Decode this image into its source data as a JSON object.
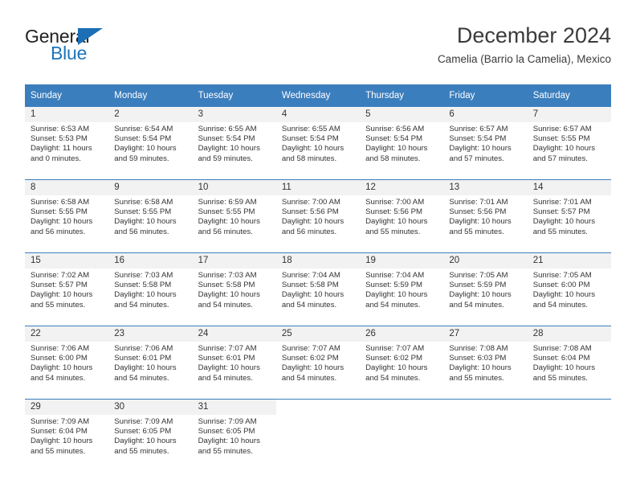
{
  "brand": {
    "name_part1": "General",
    "name_part2": "Blue",
    "accent_color": "#1c75bc",
    "triangle_color": "#1c6fb5"
  },
  "header": {
    "title": "December 2024",
    "subtitle": "Camelia (Barrio la Camelia), Mexico"
  },
  "theme": {
    "header_bg": "#3b7ebd",
    "daynum_bg": "#f2f2f2",
    "grid_line": "#3b7ebd",
    "text": "#333333"
  },
  "weekdays": [
    "Sunday",
    "Monday",
    "Tuesday",
    "Wednesday",
    "Thursday",
    "Friday",
    "Saturday"
  ],
  "weeks": [
    [
      {
        "day": "1",
        "sunrise": "Sunrise: 6:53 AM",
        "sunset": "Sunset: 5:53 PM",
        "daylight_line1": "Daylight: 11 hours",
        "daylight_line2": "and 0 minutes."
      },
      {
        "day": "2",
        "sunrise": "Sunrise: 6:54 AM",
        "sunset": "Sunset: 5:54 PM",
        "daylight_line1": "Daylight: 10 hours",
        "daylight_line2": "and 59 minutes."
      },
      {
        "day": "3",
        "sunrise": "Sunrise: 6:55 AM",
        "sunset": "Sunset: 5:54 PM",
        "daylight_line1": "Daylight: 10 hours",
        "daylight_line2": "and 59 minutes."
      },
      {
        "day": "4",
        "sunrise": "Sunrise: 6:55 AM",
        "sunset": "Sunset: 5:54 PM",
        "daylight_line1": "Daylight: 10 hours",
        "daylight_line2": "and 58 minutes."
      },
      {
        "day": "5",
        "sunrise": "Sunrise: 6:56 AM",
        "sunset": "Sunset: 5:54 PM",
        "daylight_line1": "Daylight: 10 hours",
        "daylight_line2": "and 58 minutes."
      },
      {
        "day": "6",
        "sunrise": "Sunrise: 6:57 AM",
        "sunset": "Sunset: 5:54 PM",
        "daylight_line1": "Daylight: 10 hours",
        "daylight_line2": "and 57 minutes."
      },
      {
        "day": "7",
        "sunrise": "Sunrise: 6:57 AM",
        "sunset": "Sunset: 5:55 PM",
        "daylight_line1": "Daylight: 10 hours",
        "daylight_line2": "and 57 minutes."
      }
    ],
    [
      {
        "day": "8",
        "sunrise": "Sunrise: 6:58 AM",
        "sunset": "Sunset: 5:55 PM",
        "daylight_line1": "Daylight: 10 hours",
        "daylight_line2": "and 56 minutes."
      },
      {
        "day": "9",
        "sunrise": "Sunrise: 6:58 AM",
        "sunset": "Sunset: 5:55 PM",
        "daylight_line1": "Daylight: 10 hours",
        "daylight_line2": "and 56 minutes."
      },
      {
        "day": "10",
        "sunrise": "Sunrise: 6:59 AM",
        "sunset": "Sunset: 5:55 PM",
        "daylight_line1": "Daylight: 10 hours",
        "daylight_line2": "and 56 minutes."
      },
      {
        "day": "11",
        "sunrise": "Sunrise: 7:00 AM",
        "sunset": "Sunset: 5:56 PM",
        "daylight_line1": "Daylight: 10 hours",
        "daylight_line2": "and 56 minutes."
      },
      {
        "day": "12",
        "sunrise": "Sunrise: 7:00 AM",
        "sunset": "Sunset: 5:56 PM",
        "daylight_line1": "Daylight: 10 hours",
        "daylight_line2": "and 55 minutes."
      },
      {
        "day": "13",
        "sunrise": "Sunrise: 7:01 AM",
        "sunset": "Sunset: 5:56 PM",
        "daylight_line1": "Daylight: 10 hours",
        "daylight_line2": "and 55 minutes."
      },
      {
        "day": "14",
        "sunrise": "Sunrise: 7:01 AM",
        "sunset": "Sunset: 5:57 PM",
        "daylight_line1": "Daylight: 10 hours",
        "daylight_line2": "and 55 minutes."
      }
    ],
    [
      {
        "day": "15",
        "sunrise": "Sunrise: 7:02 AM",
        "sunset": "Sunset: 5:57 PM",
        "daylight_line1": "Daylight: 10 hours",
        "daylight_line2": "and 55 minutes."
      },
      {
        "day": "16",
        "sunrise": "Sunrise: 7:03 AM",
        "sunset": "Sunset: 5:58 PM",
        "daylight_line1": "Daylight: 10 hours",
        "daylight_line2": "and 54 minutes."
      },
      {
        "day": "17",
        "sunrise": "Sunrise: 7:03 AM",
        "sunset": "Sunset: 5:58 PM",
        "daylight_line1": "Daylight: 10 hours",
        "daylight_line2": "and 54 minutes."
      },
      {
        "day": "18",
        "sunrise": "Sunrise: 7:04 AM",
        "sunset": "Sunset: 5:58 PM",
        "daylight_line1": "Daylight: 10 hours",
        "daylight_line2": "and 54 minutes."
      },
      {
        "day": "19",
        "sunrise": "Sunrise: 7:04 AM",
        "sunset": "Sunset: 5:59 PM",
        "daylight_line1": "Daylight: 10 hours",
        "daylight_line2": "and 54 minutes."
      },
      {
        "day": "20",
        "sunrise": "Sunrise: 7:05 AM",
        "sunset": "Sunset: 5:59 PM",
        "daylight_line1": "Daylight: 10 hours",
        "daylight_line2": "and 54 minutes."
      },
      {
        "day": "21",
        "sunrise": "Sunrise: 7:05 AM",
        "sunset": "Sunset: 6:00 PM",
        "daylight_line1": "Daylight: 10 hours",
        "daylight_line2": "and 54 minutes."
      }
    ],
    [
      {
        "day": "22",
        "sunrise": "Sunrise: 7:06 AM",
        "sunset": "Sunset: 6:00 PM",
        "daylight_line1": "Daylight: 10 hours",
        "daylight_line2": "and 54 minutes."
      },
      {
        "day": "23",
        "sunrise": "Sunrise: 7:06 AM",
        "sunset": "Sunset: 6:01 PM",
        "daylight_line1": "Daylight: 10 hours",
        "daylight_line2": "and 54 minutes."
      },
      {
        "day": "24",
        "sunrise": "Sunrise: 7:07 AM",
        "sunset": "Sunset: 6:01 PM",
        "daylight_line1": "Daylight: 10 hours",
        "daylight_line2": "and 54 minutes."
      },
      {
        "day": "25",
        "sunrise": "Sunrise: 7:07 AM",
        "sunset": "Sunset: 6:02 PM",
        "daylight_line1": "Daylight: 10 hours",
        "daylight_line2": "and 54 minutes."
      },
      {
        "day": "26",
        "sunrise": "Sunrise: 7:07 AM",
        "sunset": "Sunset: 6:02 PM",
        "daylight_line1": "Daylight: 10 hours",
        "daylight_line2": "and 54 minutes."
      },
      {
        "day": "27",
        "sunrise": "Sunrise: 7:08 AM",
        "sunset": "Sunset: 6:03 PM",
        "daylight_line1": "Daylight: 10 hours",
        "daylight_line2": "and 55 minutes."
      },
      {
        "day": "28",
        "sunrise": "Sunrise: 7:08 AM",
        "sunset": "Sunset: 6:04 PM",
        "daylight_line1": "Daylight: 10 hours",
        "daylight_line2": "and 55 minutes."
      }
    ],
    [
      {
        "day": "29",
        "sunrise": "Sunrise: 7:09 AM",
        "sunset": "Sunset: 6:04 PM",
        "daylight_line1": "Daylight: 10 hours",
        "daylight_line2": "and 55 minutes."
      },
      {
        "day": "30",
        "sunrise": "Sunrise: 7:09 AM",
        "sunset": "Sunset: 6:05 PM",
        "daylight_line1": "Daylight: 10 hours",
        "daylight_line2": "and 55 minutes."
      },
      {
        "day": "31",
        "sunrise": "Sunrise: 7:09 AM",
        "sunset": "Sunset: 6:05 PM",
        "daylight_line1": "Daylight: 10 hours",
        "daylight_line2": "and 55 minutes."
      },
      {
        "day": "",
        "sunrise": "",
        "sunset": "",
        "daylight_line1": "",
        "daylight_line2": ""
      },
      {
        "day": "",
        "sunrise": "",
        "sunset": "",
        "daylight_line1": "",
        "daylight_line2": ""
      },
      {
        "day": "",
        "sunrise": "",
        "sunset": "",
        "daylight_line1": "",
        "daylight_line2": ""
      },
      {
        "day": "",
        "sunrise": "",
        "sunset": "",
        "daylight_line1": "",
        "daylight_line2": ""
      }
    ]
  ]
}
